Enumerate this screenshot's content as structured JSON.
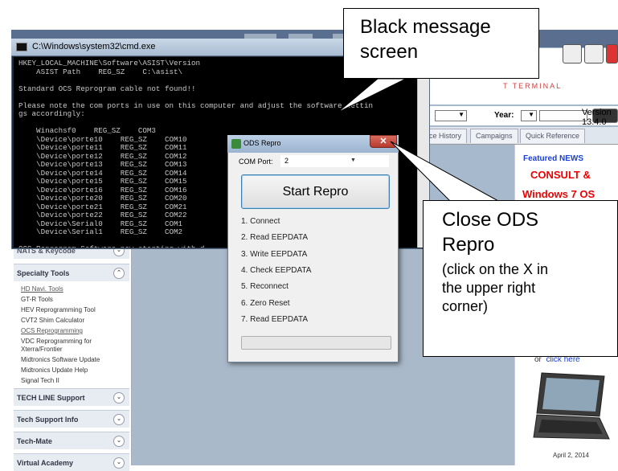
{
  "cmd_window": {
    "title": "C:\\Windows\\system32\\cmd.exe",
    "lines": "HKEY_LOCAL_MACHINE\\Software\\ASIST\\Version\n    ASIST Path    REG_SZ    C:\\asist\\\n\nStandard OCS Reprogram cable not found!!\n\nPlease note the com ports in use on this computer and adjust the software settin\ngs accordingly:\n\n    Winachsf0    REG_SZ    COM3\n    \\Device\\porte10    REG_SZ    COM10\n    \\Device\\porte11    REG_SZ    COM11\n    \\Device\\porte12    REG_SZ    COM12\n    \\Device\\porte13    REG_SZ    COM13\n    \\Device\\porte14    REG_SZ    COM14\n    \\Device\\porte15    REG_SZ    COM15\n    \\Device\\porte16    REG_SZ    COM16\n    \\Device\\porte20    REG_SZ    COM20\n    \\Device\\porte21    REG_SZ    COM21\n    \\Device\\porte22    REG_SZ    COM22\n    \\Device\\Serial0    REG_SZ    COM1\n    \\Device\\Serial1    REG_SZ    COM2\n\nOCS Reprogram Software now starting with d"
  },
  "ods_dialog": {
    "title": "ODS Repro",
    "close_label": "✕",
    "com_port_label": "COM Port:",
    "com_port_value": "2",
    "start_button": "Start Repro",
    "steps": [
      "1. Connect",
      "2. Read EEPDATA",
      "3. Write EEPDATA",
      "4. Check EEPDATA",
      "5. Reconnect",
      "6. Zero Reset",
      "7. Read EEPDATA"
    ]
  },
  "background_app": {
    "terminal_text": "T TERMINAL",
    "version": "Version 13.4.0",
    "year_label": "Year:",
    "tabs": [
      "ice History",
      "Campaigns",
      "Quick Reference"
    ],
    "sidebar": {
      "nats_header": "NATS & Keycode",
      "specialty_header": "Specialty Tools",
      "specialty_items": [
        "HD Navi. Tools",
        "GT-R Tools",
        "HEV Reprogramming Tool",
        "CVT2 Shim Calculator",
        "OCS Reprogramming",
        "VDC Reprogramming for",
        "Xterra/Frontier",
        "Midtronics Software Update",
        "Midtronics Update Help",
        "Signal Tech II"
      ],
      "other_headers": [
        "TECH LINE Support",
        "Tech Support Info",
        "Tech-Mate",
        "Virtual Academy"
      ]
    },
    "news": {
      "featured": "Featured NEWS",
      "line1": "CONSULT &",
      "line2": "Windows 7 OS",
      "or_text": "or",
      "click_here": "click here",
      "date": "April 2, 2014"
    }
  },
  "callouts": {
    "black_screen": "Black message\nscreen",
    "close_title": "Close ODS\nRepro",
    "close_sub": "(click on the X in\nthe upper right\ncorner)"
  },
  "colors": {
    "news_red": "#e00000",
    "news_blue": "#1a3fd0",
    "close_red": "#c44a3c"
  }
}
